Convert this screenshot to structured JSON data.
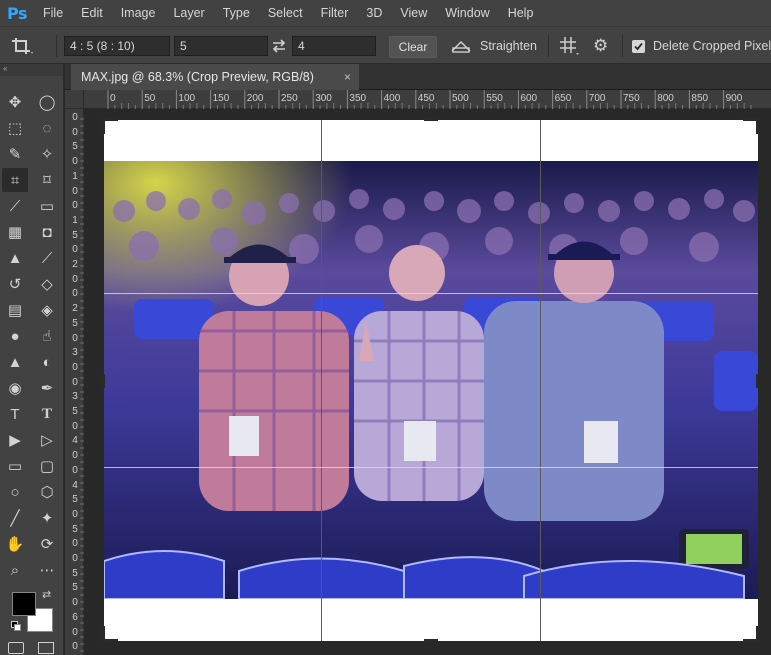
{
  "app": {
    "logo": "Ps"
  },
  "menu": [
    "File",
    "Edit",
    "Image",
    "Layer",
    "Type",
    "Select",
    "Filter",
    "3D",
    "View",
    "Window",
    "Help"
  ],
  "options": {
    "ratio_preset": "4 : 5 (8 : 10)",
    "width_value": "5",
    "height_value": "4",
    "clear_label": "Clear",
    "straighten_label": "Straighten",
    "delete_cropped_label": "Delete Cropped Pixels",
    "delete_cropped_checked": true
  },
  "document": {
    "tab_title": "MAX.jpg @ 68.3% (Crop Preview, RGB/8)",
    "close_glyph": "×"
  },
  "ruler": {
    "h_labels": [
      "0",
      "50",
      "100",
      "150",
      "200",
      "250",
      "300",
      "350",
      "400",
      "450",
      "500",
      "550",
      "600",
      "650",
      "700",
      "750",
      "800",
      "850",
      "900"
    ],
    "v_labels": [
      "0",
      "0",
      "5",
      "0",
      "1",
      "0",
      "0",
      "1",
      "5",
      "0",
      "2",
      "0",
      "0",
      "2",
      "5",
      "0",
      "3",
      "0",
      "0",
      "3",
      "5",
      "0",
      "4",
      "0",
      "0",
      "4",
      "5",
      "0",
      "5",
      "0",
      "0",
      "5",
      "5",
      "0",
      "6",
      "0",
      "0"
    ]
  },
  "colors": {
    "foreground": "#000000",
    "background": "#ffffff",
    "accent": "#31a8ff"
  },
  "tools": [
    "move-tool-icon",
    "lasso-icon",
    "marquee-rect-icon",
    "marquee-ellipse-icon",
    "quick-select-icon",
    "magic-wand-icon",
    "crop-tool-icon",
    "perspective-crop-icon",
    "eyedropper-icon",
    "ruler-tool-icon",
    "healing-brush-icon",
    "patch-icon",
    "clone-stamp-icon",
    "brush-icon",
    "history-brush-icon",
    "eraser-icon",
    "gradient-icon",
    "paint-bucket-icon",
    "blur-icon",
    "smudge-icon",
    "sharpen-icon",
    "dodge-icon",
    "sponge-icon",
    "pen-icon",
    "vertical-type-icon",
    "horizontal-type-icon",
    "path-select-icon",
    "direct-select-icon",
    "rectangle-icon",
    "rounded-rect-icon",
    "ellipse-icon",
    "polygon-icon",
    "line-icon",
    "custom-shape-icon",
    "hand-icon",
    "rotate-view-icon",
    "zoom-icon",
    "more-tools-icon"
  ]
}
